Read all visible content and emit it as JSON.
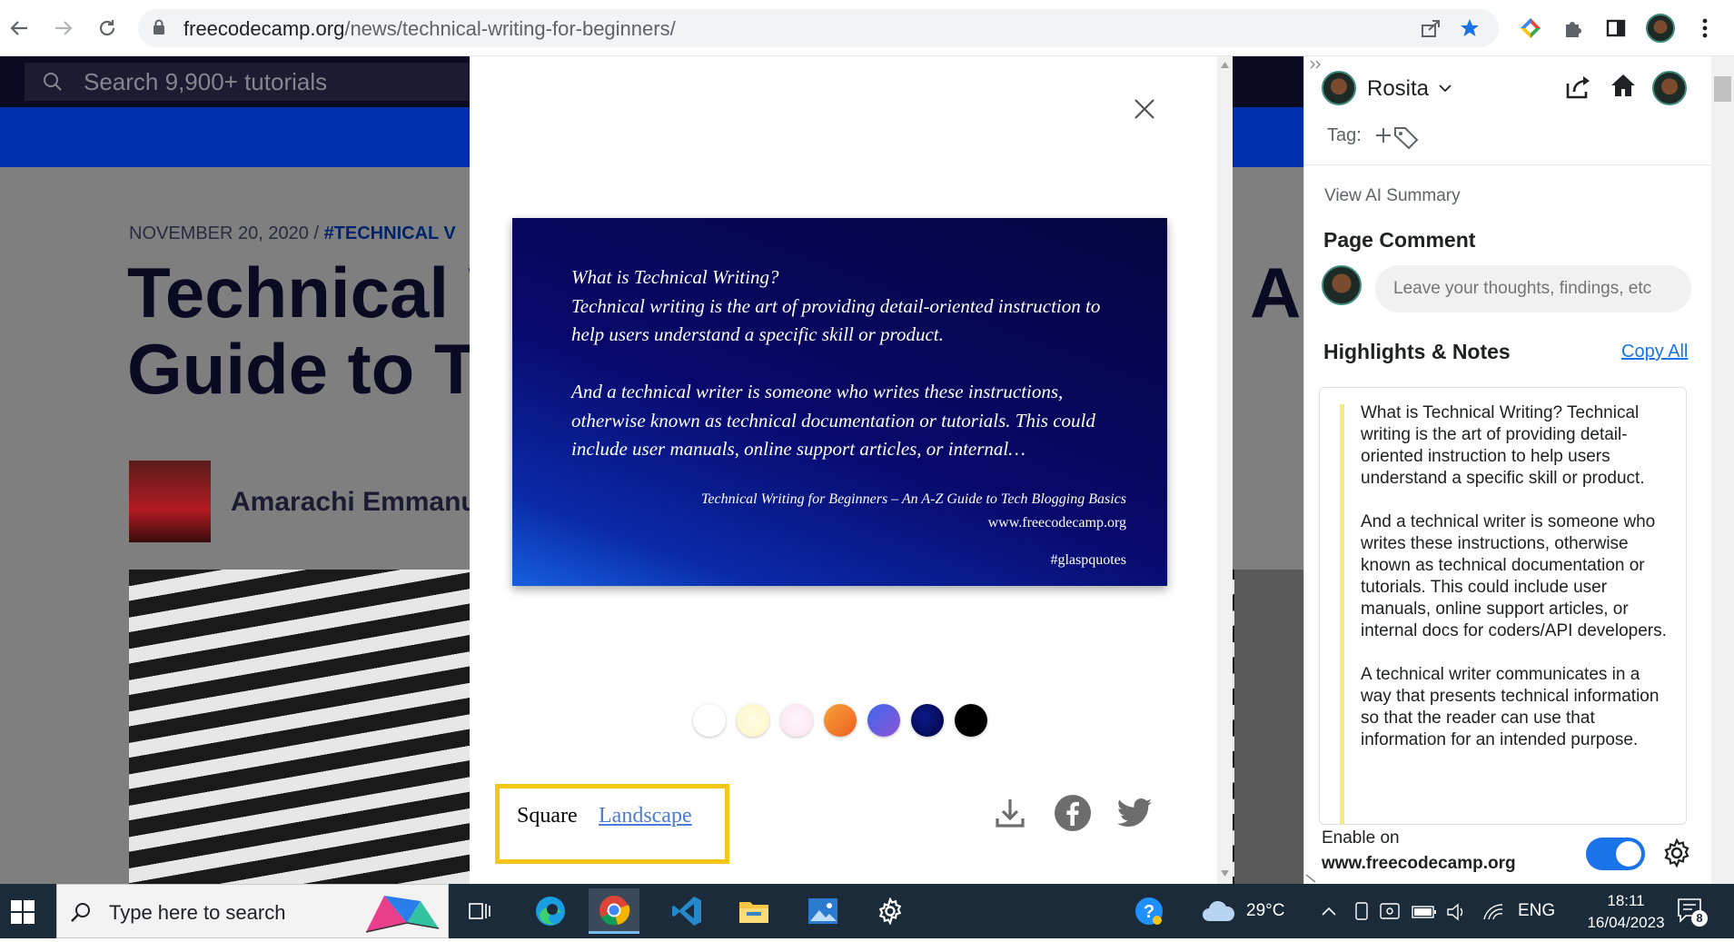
{
  "browser": {
    "url_host": "freecodecamp.org",
    "url_path": "/news/technical-writing-for-beginners/"
  },
  "article": {
    "search_placeholder": "Search 9,900+ tutorials",
    "date": "NOVEMBER 20, 2020",
    "date_sep": "/",
    "tag": "#TECHNICAL V",
    "title_line1": "Technical W",
    "title_line2": "Guide to Te",
    "title_right": "A-",
    "author": "Amarachi Emmanue"
  },
  "modal": {
    "quote_text": "What is Technical Writing?\nTechnical writing is the art of providing detail-oriented instruction to help users understand a specific skill or product.\n\nAnd a technical writer is someone who writes these instructions, otherwise known as technical documentation or tutorials. This could include user manuals, online support articles, or internal…",
    "source": "Technical Writing for Beginners – An A-Z Guide to Tech Blogging Basics",
    "source_url": "www.freecodecamp.org",
    "hashtag": "#glaspquotes",
    "swatches": [
      "#ffffff",
      "#fdfbd3",
      "#fdeef5",
      "#f5822a",
      "#6a5ae0",
      "#08086a",
      "#000000"
    ],
    "format_square": "Square",
    "format_landscape": "Landscape"
  },
  "panel": {
    "user_name": "Rosita",
    "tag_label": "Tag:",
    "ai_summary": "View AI Summary",
    "page_comment_title": "Page Comment",
    "comment_placeholder": "Leave your thoughts, findings, etc",
    "highlights_title": "Highlights & Notes",
    "copy_all": "Copy All",
    "notes": [
      "What is Technical Writing? Technical writing is the art of providing detail-oriented instruction to help users understand a specific skill or product.",
      "And a technical writer is someone who writes these instructions, otherwise known as technical documentation or tutorials. This could include user manuals, online support articles, or internal docs for coders/API developers.",
      "A technical writer communicates in a way that presents technical information so that the reader can use that information for an intended purpose."
    ],
    "enable_label": "Enable on",
    "enable_domain": "www.freecodecamp.org"
  },
  "taskbar": {
    "search_placeholder": "Type here to search",
    "weather": "29°C",
    "language": "ENG",
    "time": "18:11",
    "date": "16/04/2023",
    "notification_count": "8"
  }
}
